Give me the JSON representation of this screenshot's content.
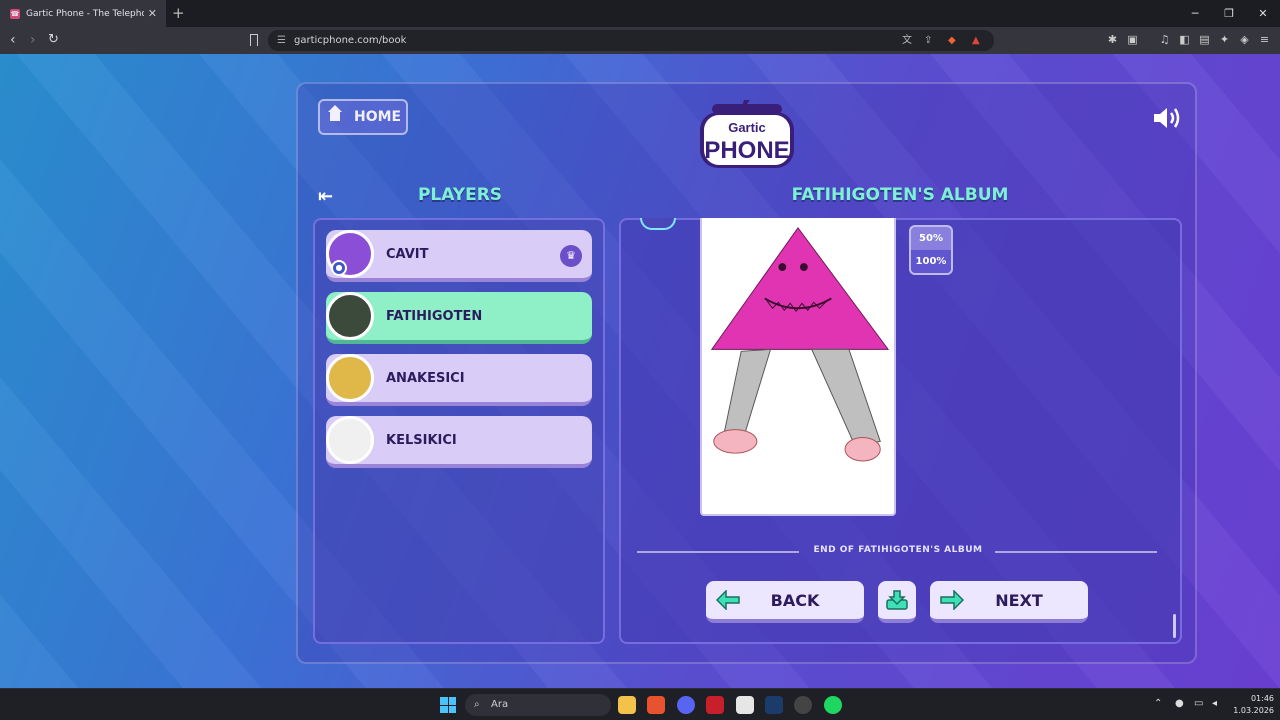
{
  "browser": {
    "tab_title": "Gartic Phone - The Telephone Ga",
    "tab_close": "✕",
    "new_tab": "+",
    "url": "garticphone.com/book",
    "window_controls": [
      "─",
      "❐",
      "✕"
    ]
  },
  "game": {
    "home_label": "HOME",
    "logo_top": "Gartic",
    "logo_bottom": "PHONE",
    "players_title": "PLAYERS",
    "album_title": "FATIHIGOTEN'S ALBUM",
    "players": [
      {
        "name": "CAVIT",
        "active": false,
        "host": true,
        "avatar_color": "#8a4fd6"
      },
      {
        "name": "FATIHIGOTEN",
        "active": true,
        "host": false,
        "avatar_color": "#3b4a3a"
      },
      {
        "name": "ANAKESICI",
        "active": false,
        "host": false,
        "avatar_color": "#e0b84a"
      },
      {
        "name": "KELSIKICI",
        "active": false,
        "host": false,
        "avatar_color": "#f0f0f0"
      }
    ],
    "zoom_options": [
      "50%",
      "100%"
    ],
    "zoom_selected": "50%",
    "end_text": "END OF FATIHIGOTEN'S ALBUM",
    "back_label": "BACK",
    "next_label": "NEXT"
  },
  "taskbar": {
    "search_placeholder": "Ara",
    "time": "01:46",
    "date": "1.03.2026"
  },
  "colors": {
    "accent": "#7ff0d6",
    "active_player": "#8ff0c8",
    "player": "#d9cdf7"
  }
}
